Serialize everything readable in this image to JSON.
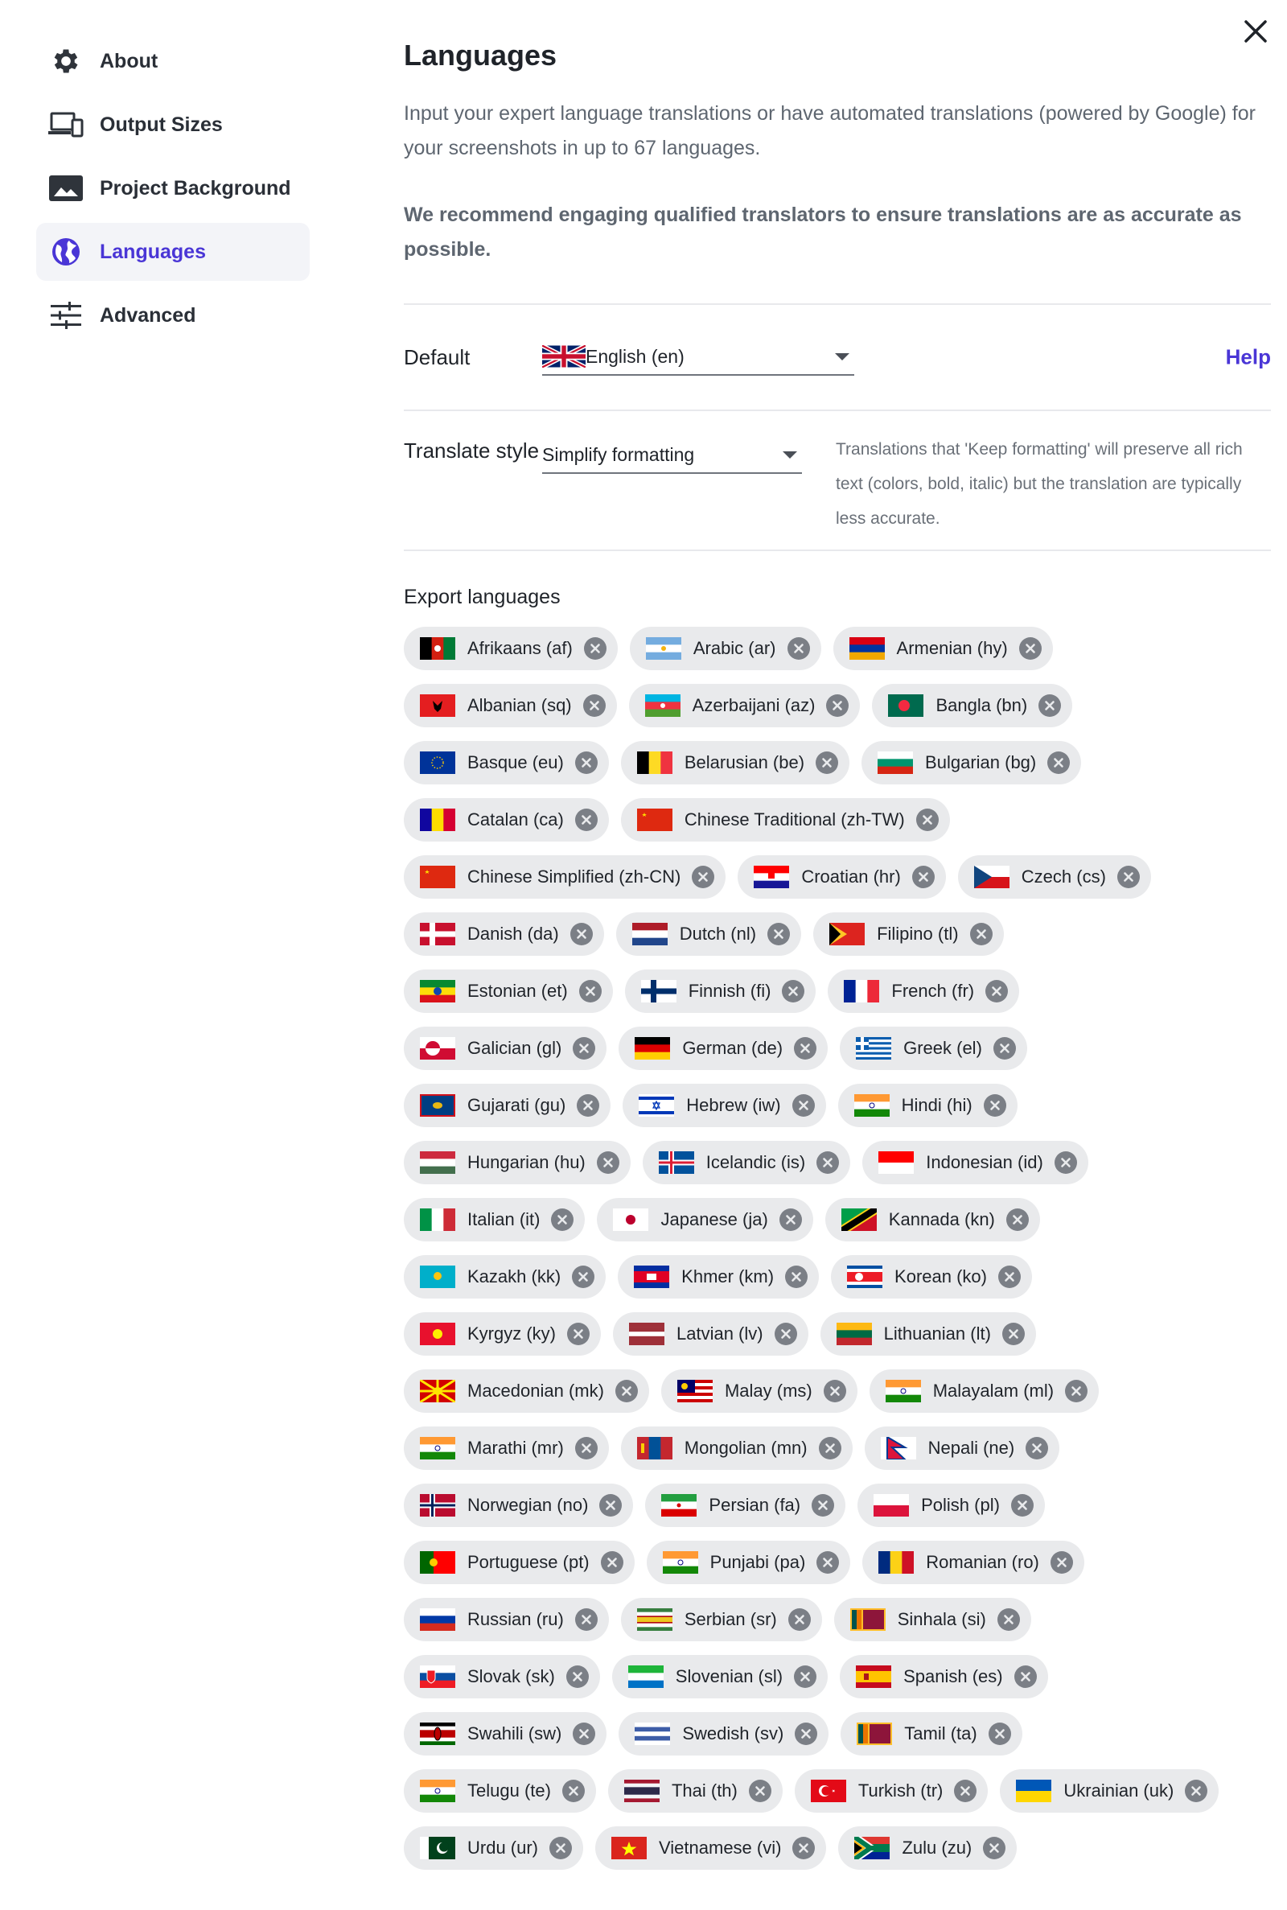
{
  "sidebar": {
    "items": [
      {
        "label": "About",
        "icon": "gear-icon"
      },
      {
        "label": "Output Sizes",
        "icon": "devices-icon"
      },
      {
        "label": "Project Background",
        "icon": "image-icon"
      },
      {
        "label": "Languages",
        "icon": "globe-icon",
        "active": true
      },
      {
        "label": "Advanced",
        "icon": "sliders-icon"
      }
    ]
  },
  "main": {
    "title": "Languages",
    "description": "Input your expert language translations or have automated translations (powered by Google) for your screenshots in up to 67 languages.",
    "recommendation": "We recommend engaging qualified translators to ensure translations are as accurate as possible.",
    "default": {
      "label": "Default",
      "value": "English (en)",
      "help": "Help"
    },
    "translate_style": {
      "label": "Translate style",
      "value": "Simplify formatting",
      "hint": "Translations that 'Keep formatting' will preserve all rich text (colors, bold, italic) but the translation are typically less accurate."
    },
    "export_title": "Export languages",
    "languages": [
      [
        "Afrikaans (af)",
        "Arabic (ar)",
        "Armenian (hy)"
      ],
      [
        "Albanian (sq)",
        "Azerbaijani (az)",
        "Bangla (bn)"
      ],
      [
        "Basque (eu)",
        "Belarusian (be)",
        "Bulgarian (bg)"
      ],
      [
        "Catalan (ca)",
        "Chinese Traditional (zh-TW)"
      ],
      [
        "Chinese Simplified (zh-CN)",
        "Croatian (hr)",
        "Czech (cs)"
      ],
      [
        "Danish (da)",
        "Dutch (nl)",
        "Filipino (tl)"
      ],
      [
        "Estonian (et)",
        "Finnish (fi)",
        "French (fr)"
      ],
      [
        "Galician (gl)",
        "German (de)",
        "Greek (el)"
      ],
      [
        "Gujarati (gu)",
        "Hebrew (iw)",
        "Hindi (hi)"
      ],
      [
        "Hungarian (hu)",
        "Icelandic (is)",
        "Indonesian (id)"
      ],
      [
        "Italian (it)",
        "Japanese (ja)",
        "Kannada (kn)"
      ],
      [
        "Kazakh (kk)",
        "Khmer (km)",
        "Korean (ko)"
      ],
      [
        "Kyrgyz (ky)",
        "Latvian (lv)",
        "Lithuanian (lt)"
      ],
      [
        "Macedonian (mk)",
        "Malay (ms)",
        "Malayalam (ml)"
      ],
      [
        "Marathi (mr)",
        "Mongolian (mn)",
        "Nepali (ne)"
      ],
      [
        "Norwegian (no)",
        "Persian (fa)",
        "Polish (pl)"
      ],
      [
        "Portuguese (pt)",
        "Punjabi (pa)",
        "Romanian (ro)"
      ],
      [
        "Russian (ru)",
        "Serbian (sr)",
        "Sinhala (si)"
      ],
      [
        "Slovak (sk)",
        "Slovenian (sl)",
        "Spanish (es)"
      ],
      [
        "Swahili (sw)",
        "Swedish (sv)",
        "Tamil (ta)"
      ],
      [
        "Telugu (te)",
        "Thai (th)",
        "Turkish (tr)",
        "Ukrainian (uk)"
      ],
      [
        "Urdu (ur)",
        "Vietnamese (vi)",
        "Zulu (zu)"
      ]
    ]
  },
  "colors": {
    "accent": "#4a36d6",
    "chip_bg": "#e9eaec",
    "remove_bg": "#7b7f86"
  }
}
